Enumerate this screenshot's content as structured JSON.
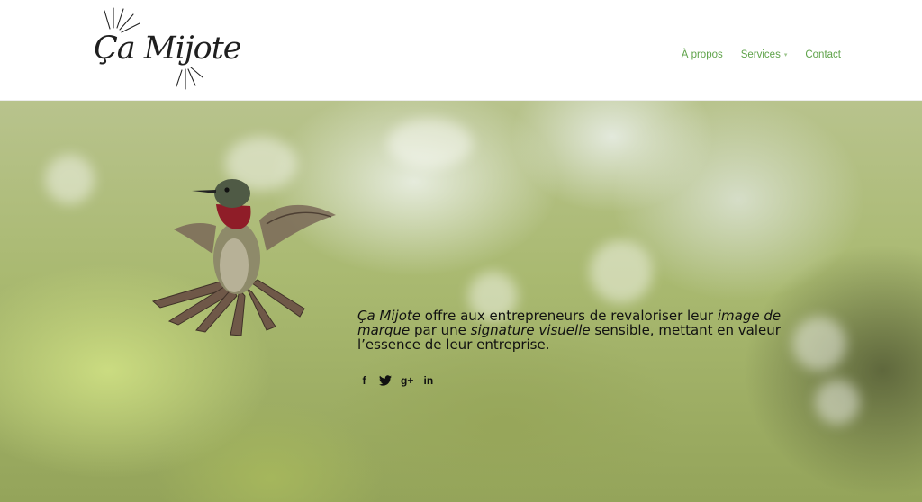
{
  "header": {
    "logo_text": "Ça Mijote",
    "nav": [
      {
        "label": "À propos"
      },
      {
        "label": "Services",
        "has_dropdown": true,
        "caret": "▾"
      },
      {
        "label": "Contact"
      }
    ]
  },
  "hero": {
    "tagline": {
      "brand": "Ça Mijote",
      "part1": " offre aux entrepreneurs de revaloriser leur ",
      "emph1": "image de marque",
      "part2": " par une ",
      "emph2": "signature visuelle",
      "part3": " sensible, mettant en valeur l’essence de leur entreprise."
    },
    "social": [
      {
        "icon": "facebook-icon",
        "glyph": "f"
      },
      {
        "icon": "twitter-icon",
        "glyph": ""
      },
      {
        "icon": "google-plus-icon",
        "glyph": "g+"
      },
      {
        "icon": "linkedin-icon",
        "glyph": "in"
      }
    ]
  },
  "colors": {
    "nav_link": "#5fa34a",
    "text": "#111111",
    "header_bg": "#ffffff"
  }
}
